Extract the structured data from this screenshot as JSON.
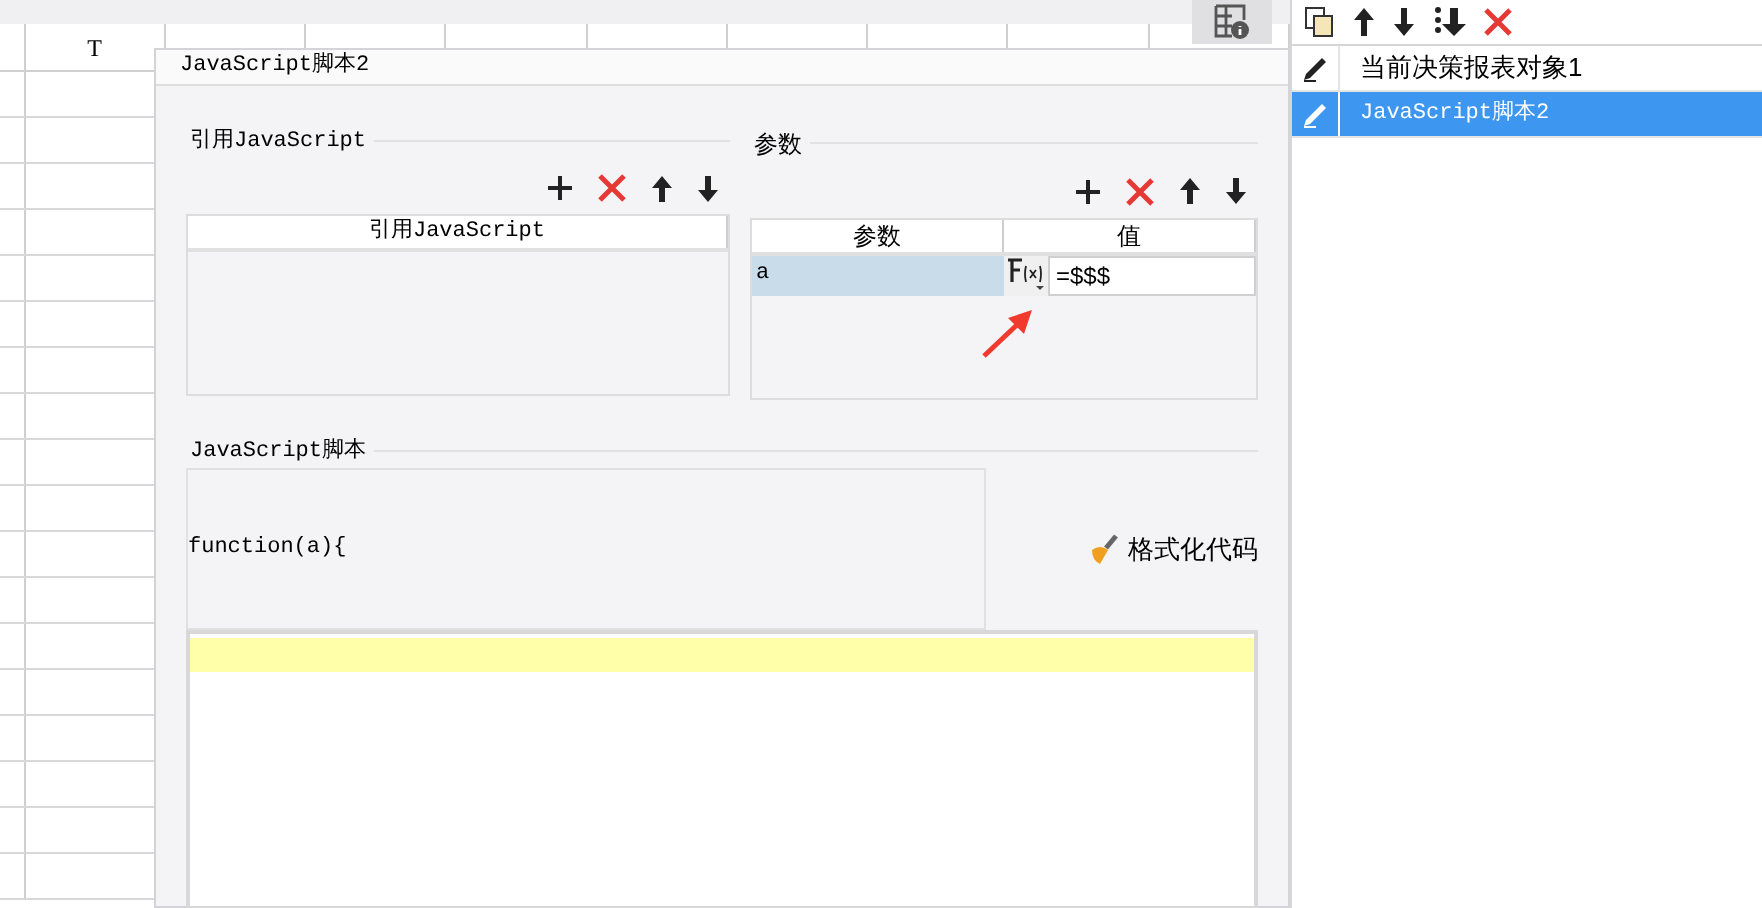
{
  "spreadsheet": {
    "column_headers": [
      "T"
    ]
  },
  "dialog": {
    "title": "JavaScript脚本2",
    "references": {
      "label": "引用JavaScript",
      "table": {
        "columns": [
          "引用JavaScript"
        ]
      }
    },
    "parameters": {
      "label": "参数",
      "table": {
        "columns": [
          "参数",
          "值"
        ],
        "rows": [
          {
            "name": "a",
            "value": "=$$$",
            "selected": true
          }
        ]
      }
    },
    "script": {
      "label": "JavaScript脚本",
      "code": "function(a){",
      "format_button": "格式化代码"
    }
  },
  "object_list": {
    "items": [
      {
        "label": "当前决策报表对象1",
        "selected": false
      },
      {
        "label": "JavaScript脚本2",
        "selected": true
      }
    ]
  }
}
